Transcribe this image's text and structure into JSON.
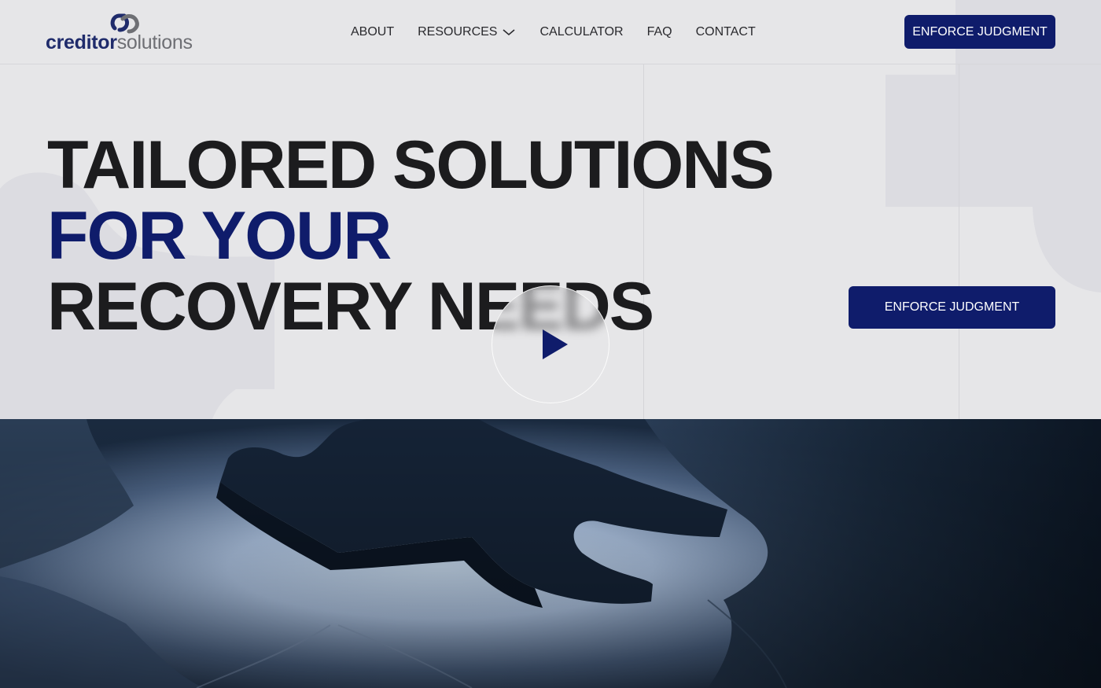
{
  "brand": {
    "name_bold": "creditor",
    "name_light": "solutions",
    "logo_icon": "chain-link-icon",
    "primary_color": "#0f1c6b",
    "secondary_color": "#6e6f74"
  },
  "nav": {
    "items": [
      {
        "label": "ABOUT"
      },
      {
        "label": "RESOURCES",
        "has_dropdown": true,
        "dropdown_icon": "chevron-down-icon"
      },
      {
        "label": "CALCULATOR"
      },
      {
        "label": "FAQ"
      },
      {
        "label": "CONTACT"
      }
    ],
    "cta_label": "ENFORCE JUDGMENT"
  },
  "hero": {
    "title_line1": "TAILORED SOLUTIONS",
    "title_line2": "FOR YOUR",
    "title_line3": "RECOVERY NEEDS",
    "cta_label": "ENFORCE JUDGMENT",
    "play_icon": "play-icon",
    "background_color": "#e6e6e8",
    "accent_text_color": "#0f1c6b"
  },
  "media": {
    "image_subject": "puzzle-pieces-image"
  }
}
